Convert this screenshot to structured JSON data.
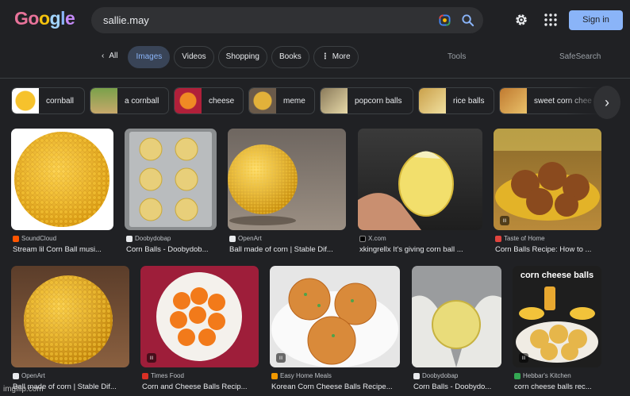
{
  "logo": {
    "letters": [
      "G",
      "o",
      "o",
      "g",
      "l",
      "e"
    ]
  },
  "search": {
    "query": "sallie.may"
  },
  "header": {
    "signin_label": "Sign in"
  },
  "tabs": {
    "all": "All",
    "items": [
      "Images",
      "Videos",
      "Shopping",
      "Books"
    ],
    "more": "More",
    "tools": "Tools",
    "safesearch": "SafeSearch"
  },
  "chips": [
    "cornball",
    "a cornball",
    "cheese",
    "meme",
    "popcorn balls",
    "rice balls",
    "sweet corn chee"
  ],
  "results_row1": [
    {
      "source": "SoundCloud",
      "title": "Stream lil Corn Ball musi...",
      "fav_color": "#ff5500"
    },
    {
      "source": "Doobydobap",
      "title": "Corn Balls - Doobydob...",
      "fav_color": "#e8eaed"
    },
    {
      "source": "OpenArt",
      "title": "Ball made of corn | Stable Dif...",
      "fav_color": "#e8eaed"
    },
    {
      "source": "X.com",
      "title": "xkingrellx It's giving corn ball ...",
      "fav_color": "#000000"
    },
    {
      "source": "Taste of Home",
      "title": "Corn Balls Recipe: How to ...",
      "fav_color": "#e0443e"
    }
  ],
  "results_row2": [
    {
      "source": "OpenArt",
      "title": "Ball made of corn | Stable Dif...",
      "fav_color": "#e8eaed"
    },
    {
      "source": "Times Food",
      "title": "Corn and Cheese Balls Recip...",
      "fav_color": "#d93025"
    },
    {
      "source": "Easy Home Meals",
      "title": "Korean Corn Cheese Balls Recipe...",
      "fav_color": "#f29900"
    },
    {
      "source": "Doobydobap",
      "title": "Corn Balls - Doobydo...",
      "fav_color": "#e8eaed"
    },
    {
      "source": "Hebbar's Kitchen",
      "title": "corn cheese balls rec...",
      "fav_color": "#34a853"
    }
  ],
  "image_overlay": "corn cheese balls",
  "badge_glyph": "ıı",
  "watermark": "imgflip.com"
}
